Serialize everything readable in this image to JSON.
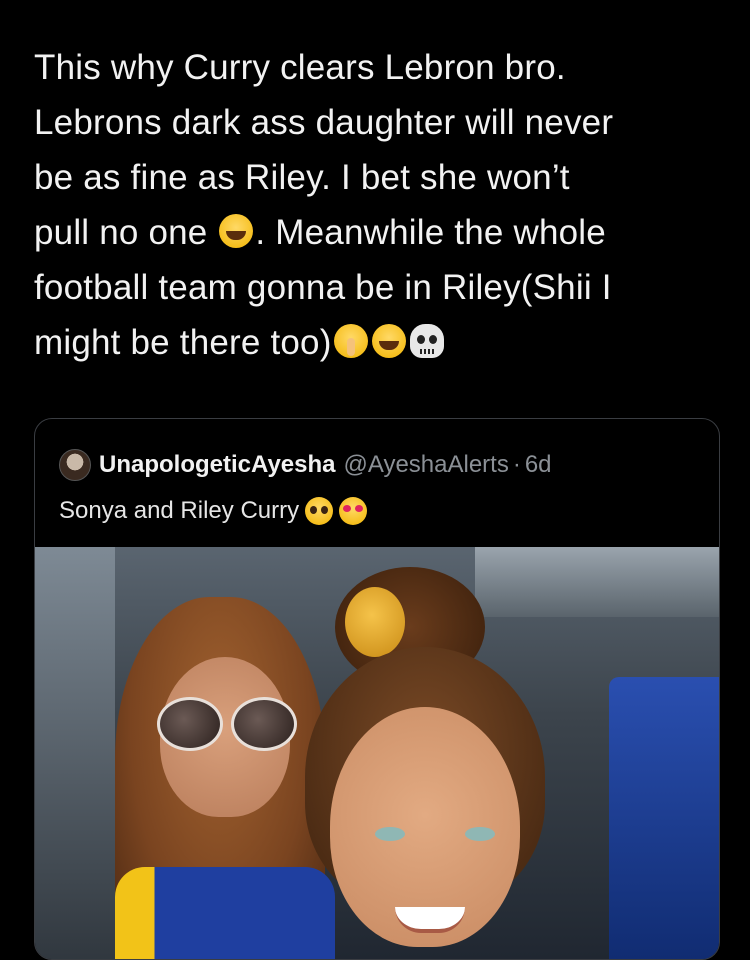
{
  "tweet": {
    "lines": [
      "This why Curry clears Lebron bro.",
      "Lebrons dark ass daughter will never",
      "be as fine as Riley. I bet she won’t",
      "pull no one",
      ". Meanwhile the whole",
      "football team gonna be in Riley(Shii I",
      "might be there too)"
    ],
    "emojis": {
      "line4": "face-with-tears-of-joy-icon",
      "line6": [
        "shushing-face-icon",
        "face-with-tears-of-joy-icon",
        "skull-icon"
      ]
    }
  },
  "quoted_tweet": {
    "display_name": "UnapologeticAyesha",
    "handle": "@AyeshaAlerts",
    "separator": "·",
    "time": "6d",
    "text": "Sonya and Riley Curry",
    "emojis": [
      "pleading-face-icon",
      "heart-eyes-icon"
    ],
    "photo_alt": "Selfie of two people on a bus"
  },
  "colors": {
    "background": "#000000",
    "text": "#f2f2f2",
    "muted": "#8b9096",
    "card_border": "#3a3d42"
  }
}
